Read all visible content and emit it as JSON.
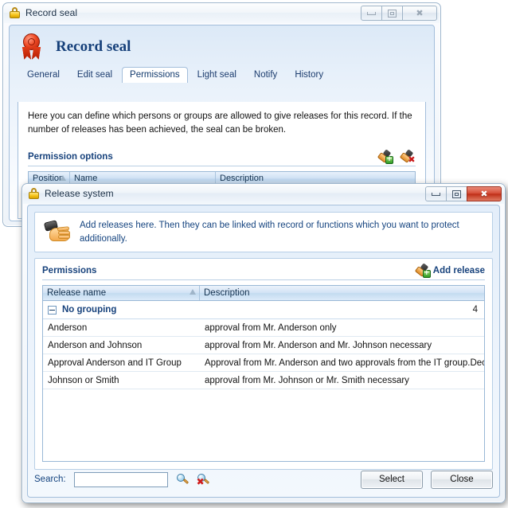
{
  "record_window": {
    "title": "Record seal",
    "lock_icon": "lock-icon",
    "buttons": {
      "minimize": "minimize",
      "maximize": "maximize",
      "close": "close"
    },
    "header": {
      "icon": "seal-ribbon-icon",
      "title": "Record seal"
    },
    "tabs": [
      {
        "label": "General",
        "active": false
      },
      {
        "label": "Edit seal",
        "active": false
      },
      {
        "label": "Permissions",
        "active": true
      },
      {
        "label": "Light seal",
        "active": false
      },
      {
        "label": "Notify",
        "active": false
      },
      {
        "label": "History",
        "active": false
      }
    ],
    "description": "Here you can define which persons or groups are allowed to give releases for this record. If the number of releases has been achieved, the seal can be broken.",
    "section": {
      "title": "Permission options",
      "actions": [
        {
          "name": "add-permission-icon"
        },
        {
          "name": "remove-permission-icon"
        }
      ]
    },
    "table": {
      "columns": [
        "Position",
        "Name",
        "Description"
      ],
      "sort_column": "Position",
      "sort_direction": "ascending",
      "rows": []
    }
  },
  "release_window": {
    "title": "Release system",
    "lock_icon": "lock-icon",
    "buttons": {
      "minimize": "minimize",
      "maximize": "maximize",
      "close": "close"
    },
    "info": {
      "icon": "hand-stamp-icon",
      "text": "Add releases here. Then they can be linked with record or functions which you want to protect additionally."
    },
    "permissions": {
      "title": "Permissions",
      "add_release_label": "Add release",
      "add_release_icon": "add-stamp-icon",
      "columns": [
        "Release name",
        "Description"
      ],
      "sort_column": "Release name",
      "sort_direction": "ascending",
      "group": {
        "label": "No grouping",
        "count": "4",
        "expanded": true
      },
      "rows": [
        {
          "name": "Anderson",
          "description": "approval from Mr. Anderson only"
        },
        {
          "name": "Anderson and Johnson",
          "description": "approval from Mr. Anderson and Mr. Johnson necessary"
        },
        {
          "name": "Approval Anderson and IT Group",
          "description": "Approval from Mr. Anderson and two approvals from the IT group.Dec"
        },
        {
          "name": "Johnson or Smith",
          "description": "approval from Mr. Johnson or Mr. Smith necessary"
        }
      ]
    },
    "footer": {
      "search_label": "Search:",
      "search_value": "",
      "search_placeholder": "",
      "search_icon": "search-magnifier-icon",
      "clear_search_icon": "clear-search-icon",
      "select_button": "Select",
      "close_button": "Close"
    }
  },
  "colors": {
    "accent_blue": "#17427c",
    "window_border": "#9eb6cd",
    "close_red": "#bf2f18",
    "header_gradient_top": "#dce9f7"
  }
}
